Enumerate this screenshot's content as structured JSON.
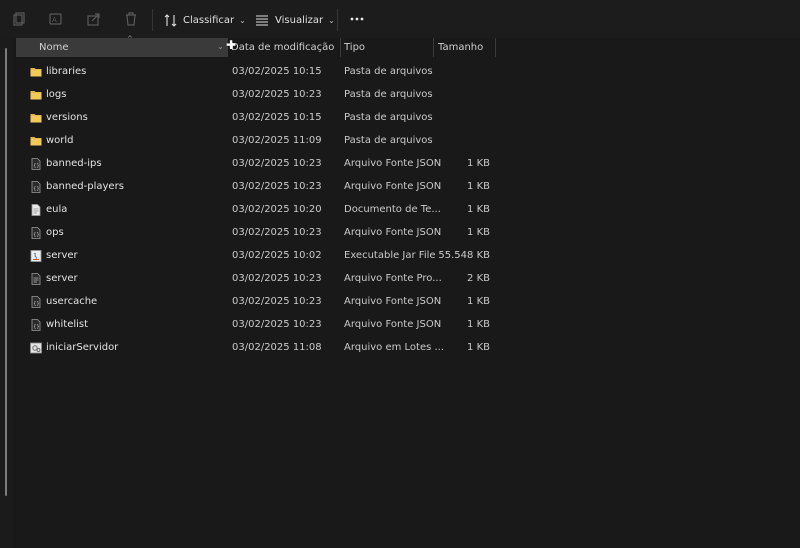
{
  "toolbar": {
    "sort_label": "Classificar",
    "view_label": "Visualizar",
    "icons": [
      "copy-icon",
      "rename-icon",
      "share-icon",
      "delete-icon",
      "sort-icon",
      "view-icon",
      "more-icon"
    ]
  },
  "columns": {
    "name": "Nome",
    "date": "Data de modificação",
    "type": "Tipo",
    "size": "Tamanho"
  },
  "files": [
    {
      "name": "libraries",
      "date": "03/02/2025 10:15",
      "type": "Pasta de arquivos",
      "size": "",
      "icon": "folder-icon"
    },
    {
      "name": "logs",
      "date": "03/02/2025 10:23",
      "type": "Pasta de arquivos",
      "size": "",
      "icon": "folder-icon"
    },
    {
      "name": "versions",
      "date": "03/02/2025 10:15",
      "type": "Pasta de arquivos",
      "size": "",
      "icon": "folder-icon"
    },
    {
      "name": "world",
      "date": "03/02/2025 11:09",
      "type": "Pasta de arquivos",
      "size": "",
      "icon": "folder-icon"
    },
    {
      "name": "banned-ips",
      "date": "03/02/2025 10:23",
      "type": "Arquivo Fonte JSON",
      "size": "1 KB",
      "icon": "json-file-icon"
    },
    {
      "name": "banned-players",
      "date": "03/02/2025 10:23",
      "type": "Arquivo Fonte JSON",
      "size": "1 KB",
      "icon": "json-file-icon"
    },
    {
      "name": "eula",
      "date": "03/02/2025 10:20",
      "type": "Documento de Te...",
      "size": "1 KB",
      "icon": "text-file-icon"
    },
    {
      "name": "ops",
      "date": "03/02/2025 10:23",
      "type": "Arquivo Fonte JSON",
      "size": "1 KB",
      "icon": "json-file-icon"
    },
    {
      "name": "server",
      "date": "03/02/2025 10:02",
      "type": "Executable Jar File",
      "size": "55.548 KB",
      "icon": "jar-file-icon"
    },
    {
      "name": "server",
      "date": "03/02/2025 10:23",
      "type": "Arquivo Fonte Pro...",
      "size": "2 KB",
      "icon": "properties-file-icon"
    },
    {
      "name": "usercache",
      "date": "03/02/2025 10:23",
      "type": "Arquivo Fonte JSON",
      "size": "1 KB",
      "icon": "json-file-icon"
    },
    {
      "name": "whitelist",
      "date": "03/02/2025 10:23",
      "type": "Arquivo Fonte JSON",
      "size": "1 KB",
      "icon": "json-file-icon"
    },
    {
      "name": "iniciarServidor",
      "date": "03/02/2025 11:08",
      "type": "Arquivo em Lotes ...",
      "size": "1 KB",
      "icon": "batch-file-icon"
    }
  ]
}
